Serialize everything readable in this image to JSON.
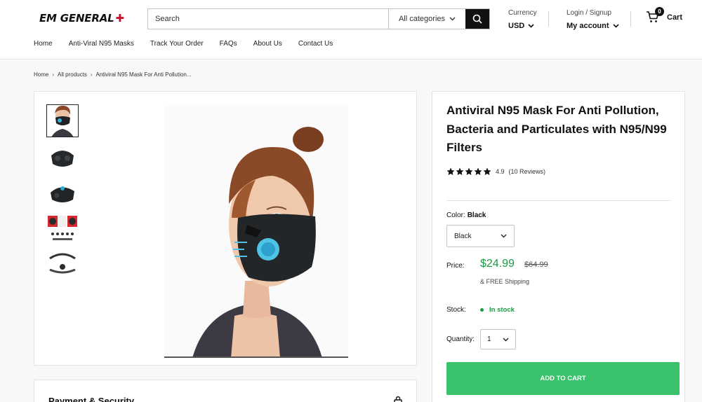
{
  "header": {
    "logo_text": "EM GENERAL",
    "logo_symbol": "✚",
    "search": {
      "placeholder": "Search",
      "category_label": "All categories"
    },
    "currency": {
      "label": "Currency",
      "value": "USD"
    },
    "account": {
      "label": "Login / Signup",
      "value": "My account"
    },
    "cart": {
      "count": "0",
      "label": "Cart"
    }
  },
  "nav": {
    "items": [
      "Home",
      "Anti-Viral N95 Masks",
      "Track Your Order",
      "FAQs",
      "About Us",
      "Contact Us"
    ]
  },
  "breadcrumb": {
    "items": [
      "Home",
      "All products",
      "Antiviral N95 Mask For Anti Pollution..."
    ],
    "separator": "›"
  },
  "product": {
    "title": "Antiviral N95 Mask For Anti Pollution, Bacteria and Particulates with N95/N99 Filters",
    "rating_value": "4.9",
    "rating_count": "(10 Reviews)",
    "stars": 5,
    "color_label": "Color:",
    "color_value": "Black",
    "color_option": "Black",
    "price_label": "Price:",
    "price": "$24.99",
    "compare_price": "$64.99",
    "shipping": "& FREE Shipping",
    "stock_label": "Stock:",
    "stock_status": "In stock",
    "quantity_label": "Quantity:",
    "quantity_value": "1",
    "add_to_cart": "ADD TO CART"
  },
  "payment": {
    "title": "Payment & Security"
  },
  "colors": {
    "accent_green": "#3ac16b",
    "price_green": "#1a9a43",
    "logo_red": "#c8102e",
    "dark": "#111111"
  }
}
